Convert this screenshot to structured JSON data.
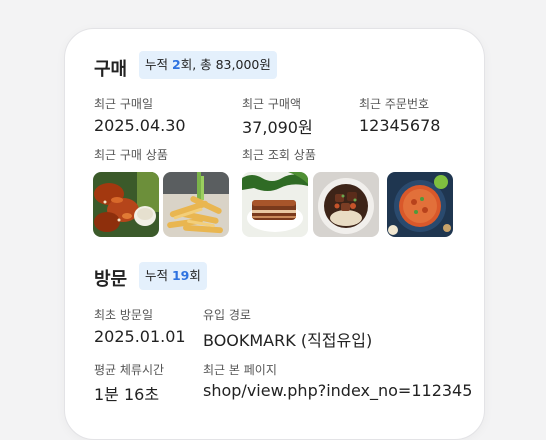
{
  "purchase": {
    "title": "구매",
    "badge_prefix": "누적 ",
    "badge_count": "2",
    "badge_suffix": "회, 총 83,000원",
    "fields": [
      {
        "label": "최근 구매일",
        "value": "2025.04.30"
      },
      {
        "label": "최근 구매액",
        "value": "37,090원"
      },
      {
        "label": "최근 주문번호",
        "value": "12345678"
      }
    ],
    "recent_purchase_label": "최근 구매 상품",
    "recent_view_label": "최근 조회 상품",
    "recent_purchase_items": [
      "chicken-wings-image",
      "french-fries-image"
    ],
    "recent_view_items": [
      "pork-belly-image",
      "beef-stew-image",
      "curry-image"
    ]
  },
  "visit": {
    "title": "방문",
    "badge_prefix": "누적 ",
    "badge_count": "19",
    "badge_suffix": "회",
    "fields": [
      {
        "label": "최초 방문일",
        "value": "2025.01.01"
      },
      {
        "label": "유입 경로",
        "value": "BOOKMARK (직접유입)"
      },
      {
        "label": "평균 체류시간",
        "value": "1분 16초"
      },
      {
        "label": "최근 본 페이지",
        "value": "shop/view.php?index_no=112345"
      }
    ]
  }
}
